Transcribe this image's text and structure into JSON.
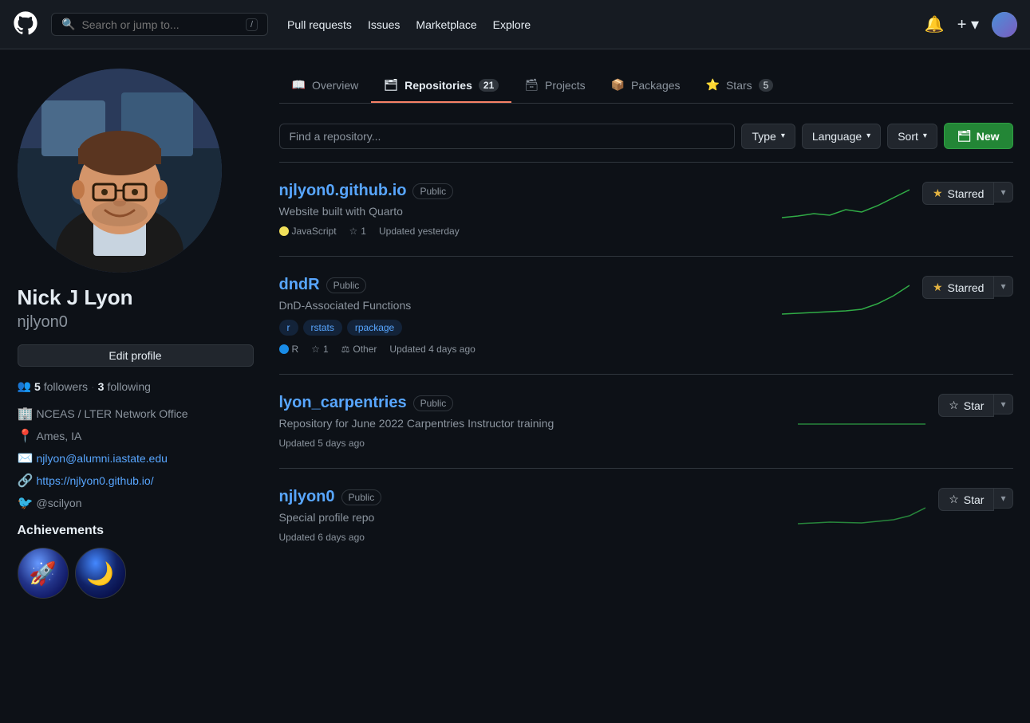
{
  "navbar": {
    "search_placeholder": "Search or jump to...",
    "shortcut": "/",
    "links": [
      "Pull requests",
      "Issues",
      "Marketplace",
      "Explore"
    ],
    "new_label": "+ ▾",
    "avatar_alt": "User avatar"
  },
  "profile": {
    "name": "Nick J Lyon",
    "username": "njlyon0",
    "followers": 5,
    "following": 3,
    "org": "NCEAS / LTER Network Office",
    "location": "Ames, IA",
    "email": "njlyon@alumni.iastate.edu",
    "website": "https://njlyon0.github.io/",
    "twitter": "@scilyon",
    "edit_profile_label": "Edit profile"
  },
  "achievements": {
    "title": "Achievements",
    "badges": [
      {
        "emoji": "🚀",
        "bg": "#1a2a4a",
        "label": "Rocket"
      },
      {
        "emoji": "🌙",
        "bg": "#0a1a3a",
        "label": "Moon"
      }
    ]
  },
  "tabs": [
    {
      "id": "overview",
      "label": "Overview",
      "icon": "📖",
      "count": null,
      "active": false
    },
    {
      "id": "repositories",
      "label": "Repositories",
      "icon": "🗂",
      "count": "21",
      "active": true
    },
    {
      "id": "projects",
      "label": "Projects",
      "icon": "🗃",
      "count": null,
      "active": false
    },
    {
      "id": "packages",
      "label": "Packages",
      "icon": "📦",
      "count": null,
      "active": false
    },
    {
      "id": "stars",
      "label": "Stars",
      "icon": "⭐",
      "count": "5",
      "active": false
    }
  ],
  "filters": {
    "search_placeholder": "Find a repository...",
    "type_label": "Type",
    "language_label": "Language",
    "sort_label": "Sort",
    "new_label": "New"
  },
  "repositories": [
    {
      "name": "njlyon0.github.io",
      "url": "#",
      "visibility": "Public",
      "description": "Website built with Quarto",
      "tags": [],
      "language": "JavaScript",
      "lang_color": "#f1e05a",
      "stars": 1,
      "forks": null,
      "other": null,
      "updated": "Updated yesterday",
      "starred": true,
      "star_btn": "Starred",
      "unstar_btn": "Star"
    },
    {
      "name": "dndR",
      "url": "#",
      "visibility": "Public",
      "description": "DnD-Associated Functions",
      "tags": [
        "r",
        "rstats",
        "rpackage"
      ],
      "language": "R",
      "lang_color": "#198ce7",
      "stars": 1,
      "forks": null,
      "other": "Other",
      "updated": "Updated 4 days ago",
      "starred": true,
      "star_btn": "Starred",
      "unstar_btn": "Star"
    },
    {
      "name": "lyon_carpentries",
      "url": "#",
      "visibility": "Public",
      "description": "Repository for June 2022 Carpentries Instructor training",
      "tags": [],
      "language": null,
      "lang_color": null,
      "stars": null,
      "forks": null,
      "other": null,
      "updated": "Updated 5 days ago",
      "starred": false,
      "star_btn": "Star",
      "unstar_btn": "Star"
    },
    {
      "name": "njlyon0",
      "url": "#",
      "visibility": "Public",
      "description": "Special profile repo",
      "tags": [],
      "language": null,
      "lang_color": null,
      "stars": null,
      "forks": null,
      "other": null,
      "updated": "Updated 6 days ago",
      "starred": false,
      "star_btn": "Star",
      "unstar_btn": "Star"
    }
  ],
  "sparklines": {
    "colors": {
      "green": "#39d353",
      "teal": "#26a69a"
    }
  }
}
